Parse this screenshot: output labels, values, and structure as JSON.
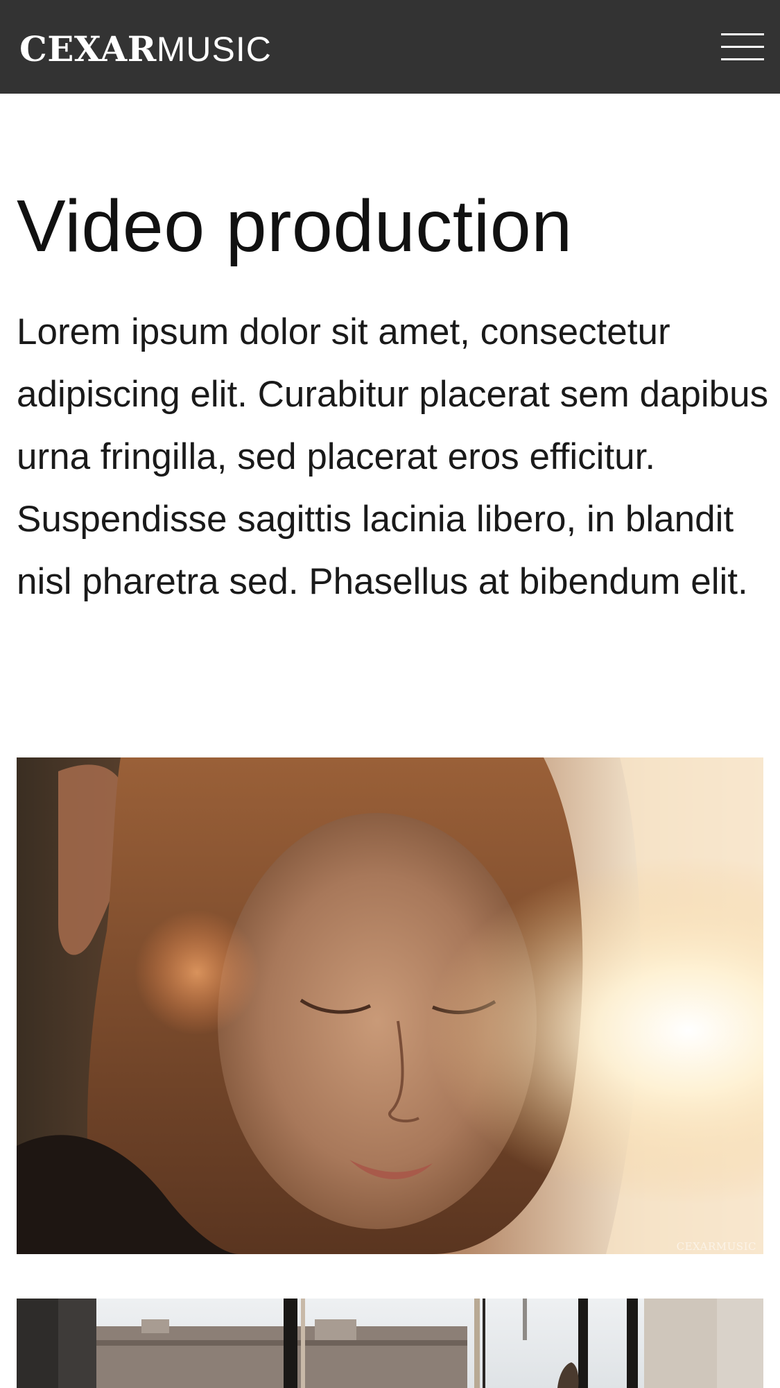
{
  "header": {
    "brand_bold": "CEXAR",
    "brand_light": "MUSIC",
    "background": "#333333",
    "menu_icon": "hamburger-menu-icon"
  },
  "main": {
    "title": "Video production",
    "intro": "Lorem ipsum dolor sit amet, consectetur adipiscing elit. Curabitur placerat sem dapibus urna fringilla, sed placerat eros efficitur. Suspendisse sagittis lacinia libero, in blandit nisl pharetra sed. Phasellus at bibendum elit.",
    "photos": [
      {
        "watermark": "CEXARMUSIC"
      },
      {}
    ]
  }
}
